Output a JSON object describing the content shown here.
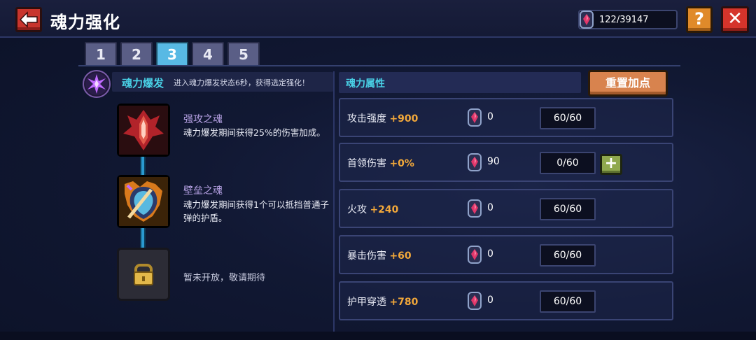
{
  "header": {
    "title": "魂力强化",
    "currency": "122/39147",
    "help_label": "?",
    "close_label": "✕"
  },
  "tabs": [
    "1",
    "2",
    "3",
    "4",
    "5"
  ],
  "active_tab": "3",
  "burst": {
    "title": "魂力爆发",
    "desc": "进入魂力爆发状态6秒，获得选定强化！"
  },
  "skills": [
    {
      "name": "强攻之魂",
      "desc": "魂力爆发期间获得25%的伤害加成。"
    },
    {
      "name": "壁垒之魂",
      "desc": "魂力爆发期间获得1个可以抵挡普通子弹的护盾。"
    }
  ],
  "locked_text": "暂未开放，敬请期待",
  "attributes": {
    "header": "魂力属性",
    "reset_label": "重置加点",
    "rows": [
      {
        "name": "攻击强度",
        "bonus": "+900",
        "cost": "0",
        "level": "60/60"
      },
      {
        "name": "首领伤害",
        "bonus": "+0%",
        "cost": "90",
        "level": "0/60"
      },
      {
        "name": "火攻",
        "bonus": "+240",
        "cost": "0",
        "level": "60/60"
      },
      {
        "name": "暴击伤害",
        "bonus": "+60",
        "cost": "0",
        "level": "60/60"
      },
      {
        "name": "护甲穿透",
        "bonus": "+780",
        "cost": "0",
        "level": "60/60"
      }
    ],
    "plus_label": "+"
  },
  "colors": {
    "accent_cyan": "#49d1e6",
    "bonus_orange": "#f2a83a",
    "skill_name_purple": "#b8a3e6",
    "active_tab": "#58b9e4"
  },
  "icons": [
    "back-arrow-icon",
    "soul-gem-icon",
    "burst-emblem-icon",
    "attack-soul-icon",
    "shield-soul-icon",
    "lock-icon",
    "plus-icon"
  ]
}
